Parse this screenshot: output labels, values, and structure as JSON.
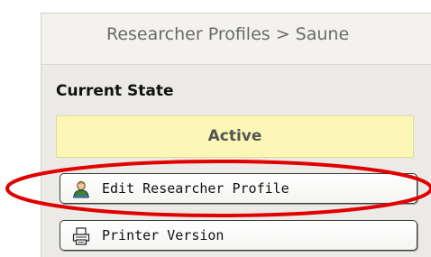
{
  "breadcrumb": {
    "text": "Researcher Profiles  >  Saune"
  },
  "current_state": {
    "title": "Current State",
    "value": "Active",
    "value_bg_color": "#fcf7b6"
  },
  "actions": [
    {
      "label": "Edit Researcher Profile",
      "icon": "user-icon"
    },
    {
      "label": "Printer Version",
      "icon": "printer-icon"
    }
  ],
  "annotation": {
    "highlight_color": "#e00000",
    "highlighted_action": "Edit Researcher Profile"
  }
}
